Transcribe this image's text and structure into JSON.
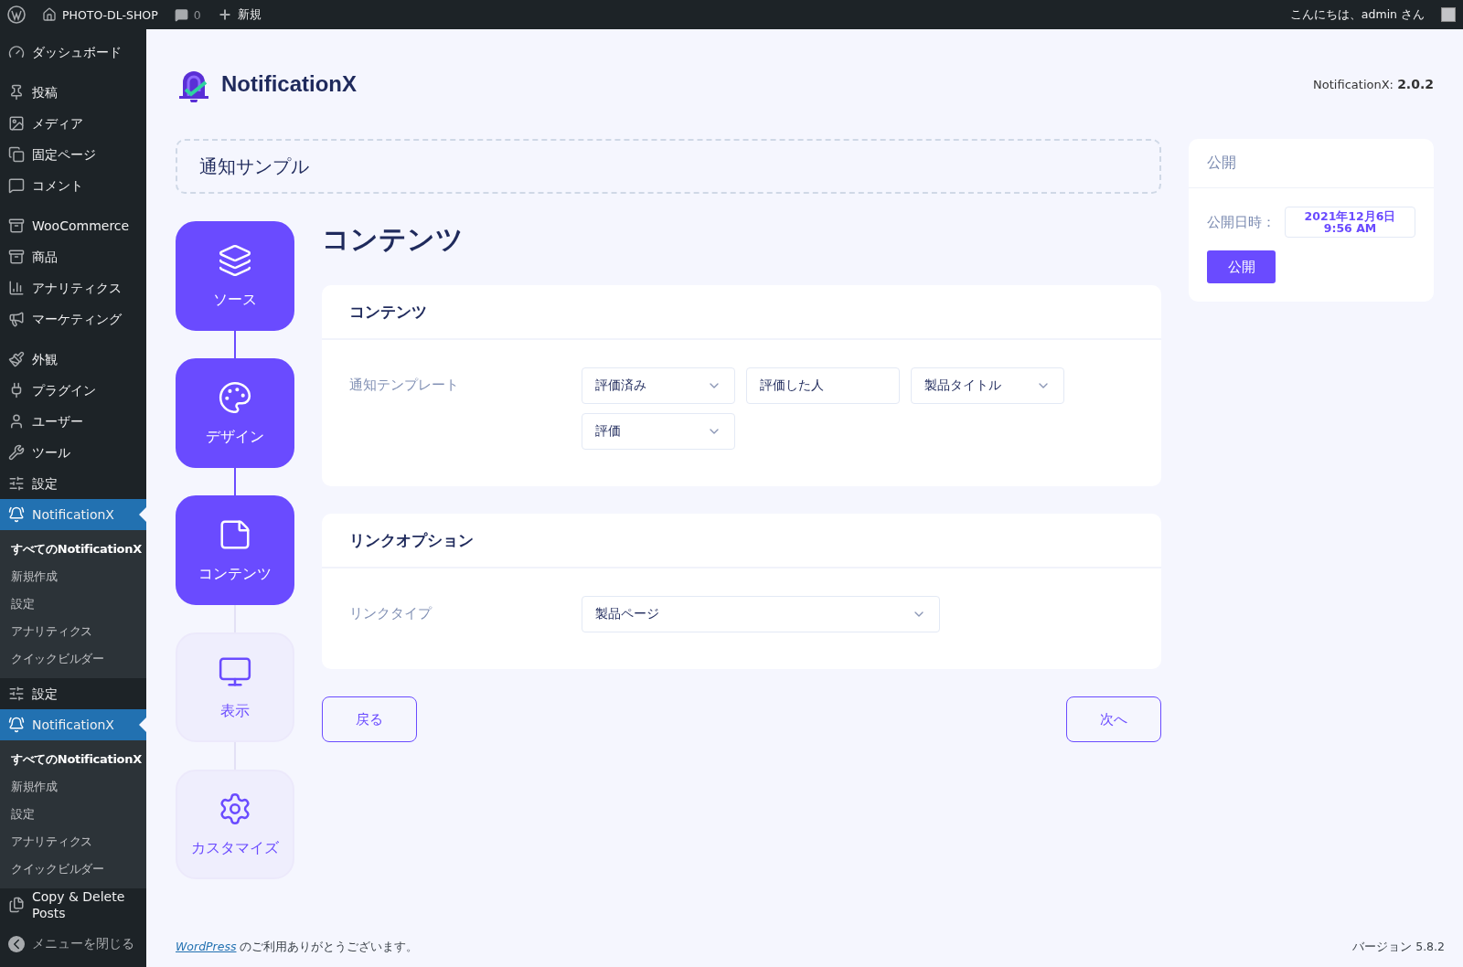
{
  "admin_bar": {
    "site": "PHOTO-DL-SHOP",
    "comments": "0",
    "new": "新規",
    "greeting": "こんにちは、admin さん"
  },
  "sidebar": {
    "groups": [
      [
        {
          "label": "ダッシュボード",
          "current": false
        }
      ],
      [
        {
          "label": "投稿",
          "current": false
        },
        {
          "label": "メディア",
          "current": false
        },
        {
          "label": "固定ページ",
          "current": false
        },
        {
          "label": "コメント",
          "current": false
        }
      ],
      [
        {
          "label": "WooCommerce",
          "current": false
        },
        {
          "label": "商品",
          "current": false
        },
        {
          "label": "アナリティクス",
          "current": false
        },
        {
          "label": "マーケティング",
          "current": false
        }
      ],
      [
        {
          "label": "外観",
          "current": false
        },
        {
          "label": "プラグイン",
          "current": false
        },
        {
          "label": "ユーザー",
          "current": false
        },
        {
          "label": "ツール",
          "current": false
        },
        {
          "label": "設定",
          "current": false
        },
        {
          "label": "NotificationX",
          "current": true,
          "submenu": [
            {
              "label": "すべてのNotificationX",
              "selected": true
            },
            {
              "label": "新規作成",
              "selected": false
            },
            {
              "label": "設定",
              "selected": false
            },
            {
              "label": "アナリティクス",
              "selected": false
            },
            {
              "label": "クイックビルダー",
              "selected": false
            }
          ]
        },
        {
          "label": "設定",
          "current": false
        },
        {
          "label": "NotificationX",
          "current": true,
          "submenu": [
            {
              "label": "すべてのNotificationX",
              "selected": true
            },
            {
              "label": "新規作成",
              "selected": false
            },
            {
              "label": "設定",
              "selected": false
            },
            {
              "label": "アナリティクス",
              "selected": false
            },
            {
              "label": "クイックビルダー",
              "selected": false
            }
          ]
        },
        {
          "label": "Copy & Delete Posts",
          "current": false
        }
      ]
    ],
    "collapse": "メニューを閉じる"
  },
  "header": {
    "logo_text": "NotificationX",
    "version_label": "NotificationX:",
    "version": "2.0.2"
  },
  "title_field": {
    "value": "通知サンプル"
  },
  "steps": [
    {
      "label": "ソース",
      "completed": true
    },
    {
      "label": "デザイン",
      "completed": true
    },
    {
      "label": "コンテンツ",
      "completed": true
    },
    {
      "label": "表示",
      "completed": false
    },
    {
      "label": "カスタマイズ",
      "completed": false
    }
  ],
  "heading": "コンテンツ",
  "sections": [
    {
      "title": "コンテンツ",
      "rows": [
        {
          "label": "通知テンプレート",
          "fields": [
            {
              "kind": "select",
              "value": "評価済み"
            },
            {
              "kind": "text",
              "value": "評価した人"
            },
            {
              "kind": "select",
              "value": "製品タイトル"
            },
            {
              "kind": "select",
              "value": "評価"
            }
          ]
        }
      ]
    },
    {
      "title": "リンクオプション",
      "rows": [
        {
          "label": "リンクタイプ",
          "fields": [
            {
              "kind": "wide-select",
              "value": "製品ページ"
            }
          ]
        }
      ]
    }
  ],
  "nav": {
    "back": "戻る",
    "next": "次へ"
  },
  "publish": {
    "title": "公開",
    "date_label": "公開日時：",
    "date": "2021年12月6日",
    "time": "9:56 AM",
    "button": "公開"
  },
  "footer": {
    "link": "WordPress",
    "thanks": " のご利用ありがとうございます。",
    "version": "バージョン 5.8.2"
  }
}
